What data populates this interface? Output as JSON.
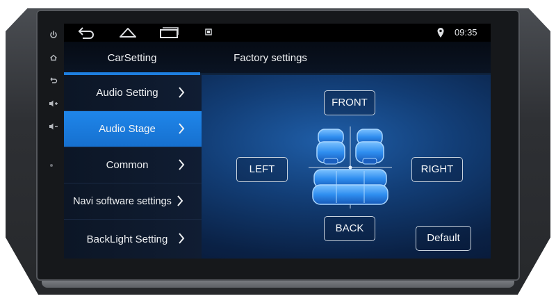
{
  "statusbar": {
    "icons": [
      "back-icon",
      "home-icon",
      "recent-apps-icon",
      "notification-icon",
      "location-icon"
    ],
    "time": "09:35"
  },
  "tabs": [
    {
      "label": "CarSetting",
      "active": true
    },
    {
      "label": "Factory settings",
      "active": false
    }
  ],
  "menu": {
    "items": [
      {
        "label": "Audio Setting",
        "active": false
      },
      {
        "label": "Audio Stage",
        "active": true
      },
      {
        "label": "Common",
        "active": false
      },
      {
        "label": "Navi software settings",
        "active": false
      },
      {
        "label": "BackLight Setting",
        "active": false
      }
    ]
  },
  "stage": {
    "front_label": "FRONT",
    "left_label": "LEFT",
    "right_label": "RIGHT",
    "back_label": "BACK",
    "default_label": "Default"
  },
  "side_buttons": [
    "power-icon",
    "home-icon",
    "back-icon",
    "volume-up-icon",
    "volume-down-icon"
  ],
  "colors": {
    "accent": "#1e7fe0",
    "active_item": "#1a7ce0",
    "seat_glow": "#3a9bff"
  }
}
